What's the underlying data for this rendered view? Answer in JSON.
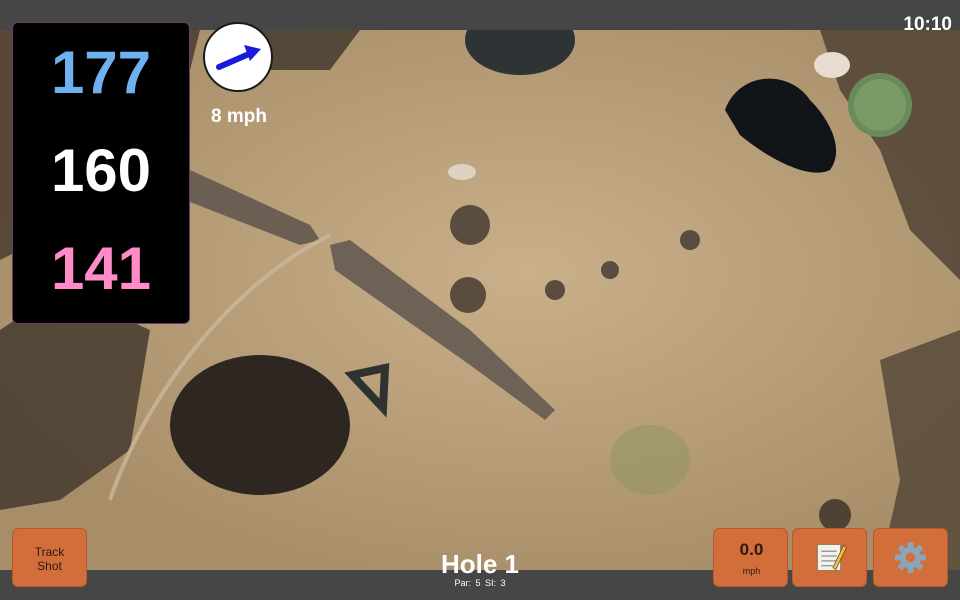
{
  "status": {
    "time": "10:10"
  },
  "distances": {
    "back": "177",
    "middle": "160",
    "front": "141"
  },
  "wind": {
    "speed": "8 mph",
    "icon": "wind-arrow-icon"
  },
  "buttons": {
    "track_shot": "Track Shot",
    "speed_value": "0.0",
    "speed_unit": "mph",
    "notes_icon": "notepad-icon",
    "settings_icon": "gear-icon"
  },
  "hole": {
    "title": "Hole 1",
    "par": "Par: 5",
    "si": "SI: 3"
  },
  "colors": {
    "back_distance": "#6fb0f0",
    "middle_distance": "#ffffff",
    "front_distance": "#ff8cc8",
    "button": "#d26e3a"
  }
}
